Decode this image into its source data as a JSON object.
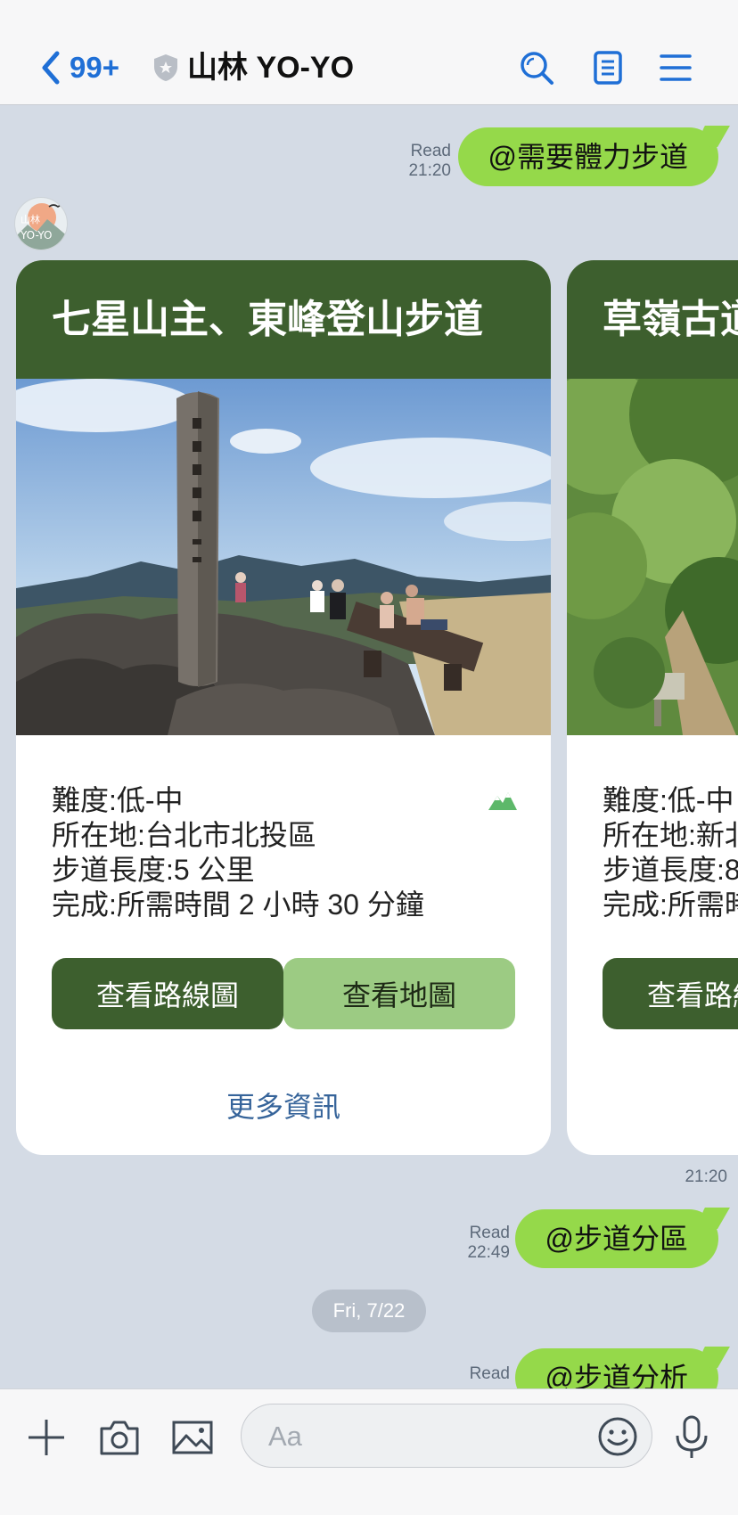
{
  "header": {
    "back_count": "99+",
    "title": "山林 YO-YO",
    "icons": [
      "chevron-left-icon",
      "shield-icon",
      "search-icon",
      "notes-icon",
      "menu-icon"
    ]
  },
  "chat": {
    "messages": [
      {
        "text": "@需要體力步道",
        "read": "Read",
        "time": "21:20"
      },
      {
        "text": "@步道分區",
        "read": "Read",
        "time": "22:49"
      },
      {
        "text": "@步道分析",
        "read": "Read",
        "time": ""
      }
    ],
    "avatar_text": [
      "山林",
      "YO-YO"
    ],
    "carousel_time": "21:20",
    "date_pill": "Fri, 7/22"
  },
  "cards": [
    {
      "title": "七星山主、東峰登山步道",
      "difficulty": "難度:低-中",
      "location": "所在地:台北市北投區",
      "length": "步道長度:5 公里",
      "duration": "完成:所需時間 2 小時 30 分鐘",
      "route_button": "查看路線圖",
      "map_button": "查看地圖",
      "more_link": "更多資訊"
    },
    {
      "title": "草嶺古道",
      "difficulty": "難度:低-中",
      "location": "所在地:新北",
      "length": "步道長度:8",
      "duration": "完成:所需時",
      "route_button": "查看路線圖"
    }
  ],
  "composer": {
    "placeholder": "Aa",
    "icons": [
      "plus-icon",
      "camera-icon",
      "image-icon",
      "smile-icon",
      "mic-icon"
    ]
  },
  "colors": {
    "accent_blue": "#1f6fd6",
    "bubble_green": "#95d94a",
    "card_header_green": "#3d5f2e",
    "light_button_green": "#9ccb83",
    "chat_background": "#d4dbe5"
  }
}
